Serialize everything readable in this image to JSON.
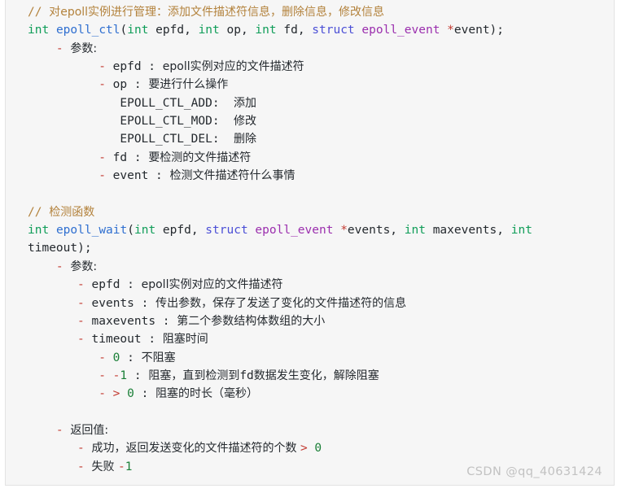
{
  "code_block": {
    "background_color": "#f6f6f6",
    "border_color": "#e3e3e3",
    "language": "c"
  },
  "colors": {
    "comment": "#b3823c",
    "keyword_int": "#0f9d58",
    "function_name": "#2f6fd0",
    "struct_keyword": "#4b4fd6",
    "type_name": "#9b2fae",
    "operator": "#c33b32",
    "number": "#1a7f37",
    "plain_text": "#24292e",
    "watermark": "#c2c2c2"
  },
  "watermark": {
    "text": "CSDN @qq_40631424"
  },
  "lines": [
    {
      "id": "line-1-comment-epoll-ctl",
      "indent": 0,
      "tokens": [
        {
          "t": "// ",
          "c": "c-comment"
        },
        {
          "t": "对epoll实例进行管理：添加文件描述符信息，删除信息，修改信息",
          "c": "c-comment",
          "cjk": true
        }
      ]
    },
    {
      "id": "line-2-signature-epoll-ctl",
      "indent": 0,
      "tokens": [
        {
          "t": "int",
          "c": "c-kw"
        },
        {
          "t": " ",
          "c": "c-plain"
        },
        {
          "t": "epoll_ctl",
          "c": "c-fn"
        },
        {
          "t": "(",
          "c": "c-plain"
        },
        {
          "t": "int",
          "c": "c-kw"
        },
        {
          "t": " epfd, ",
          "c": "c-plain"
        },
        {
          "t": "int",
          "c": "c-kw"
        },
        {
          "t": " op, ",
          "c": "c-plain"
        },
        {
          "t": "int",
          "c": "c-kw"
        },
        {
          "t": " fd, ",
          "c": "c-plain"
        },
        {
          "t": "struct",
          "c": "c-struct"
        },
        {
          "t": " ",
          "c": "c-plain"
        },
        {
          "t": "epoll_event",
          "c": "c-type"
        },
        {
          "t": " ",
          "c": "c-plain"
        },
        {
          "t": "*",
          "c": "c-op"
        },
        {
          "t": "event);",
          "c": "c-plain"
        }
      ]
    },
    {
      "id": "line-3-params-label",
      "indent": 4,
      "tokens": [
        {
          "t": "- ",
          "c": "c-op"
        },
        {
          "t": "参数:",
          "c": "c-plain",
          "cjk": true
        }
      ]
    },
    {
      "id": "line-4-param-epfd",
      "indent": 10,
      "tokens": [
        {
          "t": "- ",
          "c": "c-op"
        },
        {
          "t": "epfd : ",
          "c": "c-plain"
        },
        {
          "t": "epoll实例对应的文件描述符",
          "c": "c-plain",
          "cjk": true
        }
      ]
    },
    {
      "id": "line-5-param-op",
      "indent": 10,
      "tokens": [
        {
          "t": "- ",
          "c": "c-op"
        },
        {
          "t": "op : ",
          "c": "c-plain"
        },
        {
          "t": "要进行什么操作",
          "c": "c-plain",
          "cjk": true
        }
      ]
    },
    {
      "id": "line-6-epoll-ctl-add",
      "indent": 13,
      "tokens": [
        {
          "t": "EPOLL_CTL_ADD:  ",
          "c": "c-plain"
        },
        {
          "t": "添加",
          "c": "c-plain",
          "cjk": true
        }
      ]
    },
    {
      "id": "line-7-epoll-ctl-mod",
      "indent": 13,
      "tokens": [
        {
          "t": "EPOLL_CTL_MOD:  ",
          "c": "c-plain"
        },
        {
          "t": "修改",
          "c": "c-plain",
          "cjk": true
        }
      ]
    },
    {
      "id": "line-8-epoll-ctl-del",
      "indent": 13,
      "tokens": [
        {
          "t": "EPOLL_CTL_DEL:  ",
          "c": "c-plain"
        },
        {
          "t": "删除",
          "c": "c-plain",
          "cjk": true
        }
      ]
    },
    {
      "id": "line-9-param-fd",
      "indent": 10,
      "tokens": [
        {
          "t": "- ",
          "c": "c-op"
        },
        {
          "t": "fd : ",
          "c": "c-plain"
        },
        {
          "t": "要检测的文件描述符",
          "c": "c-plain",
          "cjk": true
        }
      ]
    },
    {
      "id": "line-10-param-event",
      "indent": 10,
      "tokens": [
        {
          "t": "- ",
          "c": "c-op"
        },
        {
          "t": "event : ",
          "c": "c-plain"
        },
        {
          "t": "检测文件描述符什么事情",
          "c": "c-plain",
          "cjk": true
        }
      ]
    },
    {
      "id": "line-11-blank",
      "indent": 0,
      "blank": true,
      "tokens": []
    },
    {
      "id": "line-12-comment-detect-fn",
      "indent": 0,
      "tokens": [
        {
          "t": "// ",
          "c": "c-comment"
        },
        {
          "t": "检测函数",
          "c": "c-comment",
          "cjk": true
        }
      ]
    },
    {
      "id": "line-13-signature-epoll-wait-part1",
      "indent": 0,
      "tokens": [
        {
          "t": "int",
          "c": "c-kw"
        },
        {
          "t": " ",
          "c": "c-plain"
        },
        {
          "t": "epoll_wait",
          "c": "c-fn"
        },
        {
          "t": "(",
          "c": "c-plain"
        },
        {
          "t": "int",
          "c": "c-kw"
        },
        {
          "t": " epfd, ",
          "c": "c-plain"
        },
        {
          "t": "struct",
          "c": "c-struct"
        },
        {
          "t": " ",
          "c": "c-plain"
        },
        {
          "t": "epoll_event",
          "c": "c-type"
        },
        {
          "t": " ",
          "c": "c-plain"
        },
        {
          "t": "*",
          "c": "c-op"
        },
        {
          "t": "events, ",
          "c": "c-plain"
        },
        {
          "t": "int",
          "c": "c-kw"
        },
        {
          "t": " maxevents, ",
          "c": "c-plain"
        },
        {
          "t": "int",
          "c": "c-kw"
        }
      ]
    },
    {
      "id": "line-14-signature-epoll-wait-part2",
      "indent": -1,
      "tokens": [
        {
          "t": "timeout);",
          "c": "c-plain"
        }
      ]
    },
    {
      "id": "line-15-params-label",
      "indent": 4,
      "tokens": [
        {
          "t": "- ",
          "c": "c-op"
        },
        {
          "t": "参数:",
          "c": "c-plain",
          "cjk": true
        }
      ]
    },
    {
      "id": "line-16-param-epfd",
      "indent": 7,
      "tokens": [
        {
          "t": "- ",
          "c": "c-op"
        },
        {
          "t": "epfd : ",
          "c": "c-plain"
        },
        {
          "t": "epoll实例对应的文件描述符",
          "c": "c-plain",
          "cjk": true
        }
      ]
    },
    {
      "id": "line-17-param-events",
      "indent": 7,
      "tokens": [
        {
          "t": "- ",
          "c": "c-op"
        },
        {
          "t": "events : ",
          "c": "c-plain"
        },
        {
          "t": "传出参数，保存了发送了变化的文件描述符的信息",
          "c": "c-plain",
          "cjk": true
        }
      ]
    },
    {
      "id": "line-18-param-maxevents",
      "indent": 7,
      "tokens": [
        {
          "t": "- ",
          "c": "c-op"
        },
        {
          "t": "maxevents : ",
          "c": "c-plain"
        },
        {
          "t": "第二个参数结构体数组的大小",
          "c": "c-plain",
          "cjk": true
        }
      ]
    },
    {
      "id": "line-19-param-timeout",
      "indent": 7,
      "tokens": [
        {
          "t": "- ",
          "c": "c-op"
        },
        {
          "t": "timeout : ",
          "c": "c-plain"
        },
        {
          "t": "阻塞时间",
          "c": "c-plain",
          "cjk": true
        }
      ]
    },
    {
      "id": "line-20-timeout-zero",
      "indent": 10,
      "tokens": [
        {
          "t": "- ",
          "c": "c-op"
        },
        {
          "t": "0",
          "c": "c-num"
        },
        {
          "t": " : ",
          "c": "c-plain"
        },
        {
          "t": "不阻塞",
          "c": "c-plain",
          "cjk": true
        }
      ]
    },
    {
      "id": "line-21-timeout-minus-one",
      "indent": 10,
      "tokens": [
        {
          "t": "- ",
          "c": "c-op"
        },
        {
          "t": "-",
          "c": "c-op"
        },
        {
          "t": "1",
          "c": "c-num"
        },
        {
          "t": " : ",
          "c": "c-plain"
        },
        {
          "t": "阻塞，直到检测到",
          "c": "c-plain",
          "cjk": true
        },
        {
          "t": "fd",
          "c": "c-plain"
        },
        {
          "t": "数据发生变化，解除阻塞",
          "c": "c-plain",
          "cjk": true
        }
      ]
    },
    {
      "id": "line-22-timeout-greater-zero",
      "indent": 10,
      "tokens": [
        {
          "t": "- ",
          "c": "c-op"
        },
        {
          "t": ">",
          "c": "c-op"
        },
        {
          "t": " ",
          "c": "c-plain"
        },
        {
          "t": "0",
          "c": "c-num"
        },
        {
          "t": " : ",
          "c": "c-plain"
        },
        {
          "t": "阻塞的时长（毫秒）",
          "c": "c-plain",
          "cjk": true
        }
      ]
    },
    {
      "id": "line-23-blank",
      "indent": 0,
      "blank": true,
      "tokens": []
    },
    {
      "id": "line-24-return-label",
      "indent": 4,
      "tokens": [
        {
          "t": "- ",
          "c": "c-op"
        },
        {
          "t": "返回值:",
          "c": "c-plain",
          "cjk": true
        }
      ]
    },
    {
      "id": "line-25-return-success",
      "indent": 7,
      "tokens": [
        {
          "t": "- ",
          "c": "c-op"
        },
        {
          "t": "成功，返回发送变化的文件描述符的个数 ",
          "c": "c-plain",
          "cjk": true
        },
        {
          "t": ">",
          "c": "c-op"
        },
        {
          "t": " ",
          "c": "c-plain"
        },
        {
          "t": "0",
          "c": "c-num"
        }
      ]
    },
    {
      "id": "line-26-return-fail",
      "indent": 7,
      "tokens": [
        {
          "t": "- ",
          "c": "c-op"
        },
        {
          "t": "失败 ",
          "c": "c-plain",
          "cjk": true
        },
        {
          "t": "-",
          "c": "c-op"
        },
        {
          "t": "1",
          "c": "c-num"
        }
      ]
    }
  ]
}
